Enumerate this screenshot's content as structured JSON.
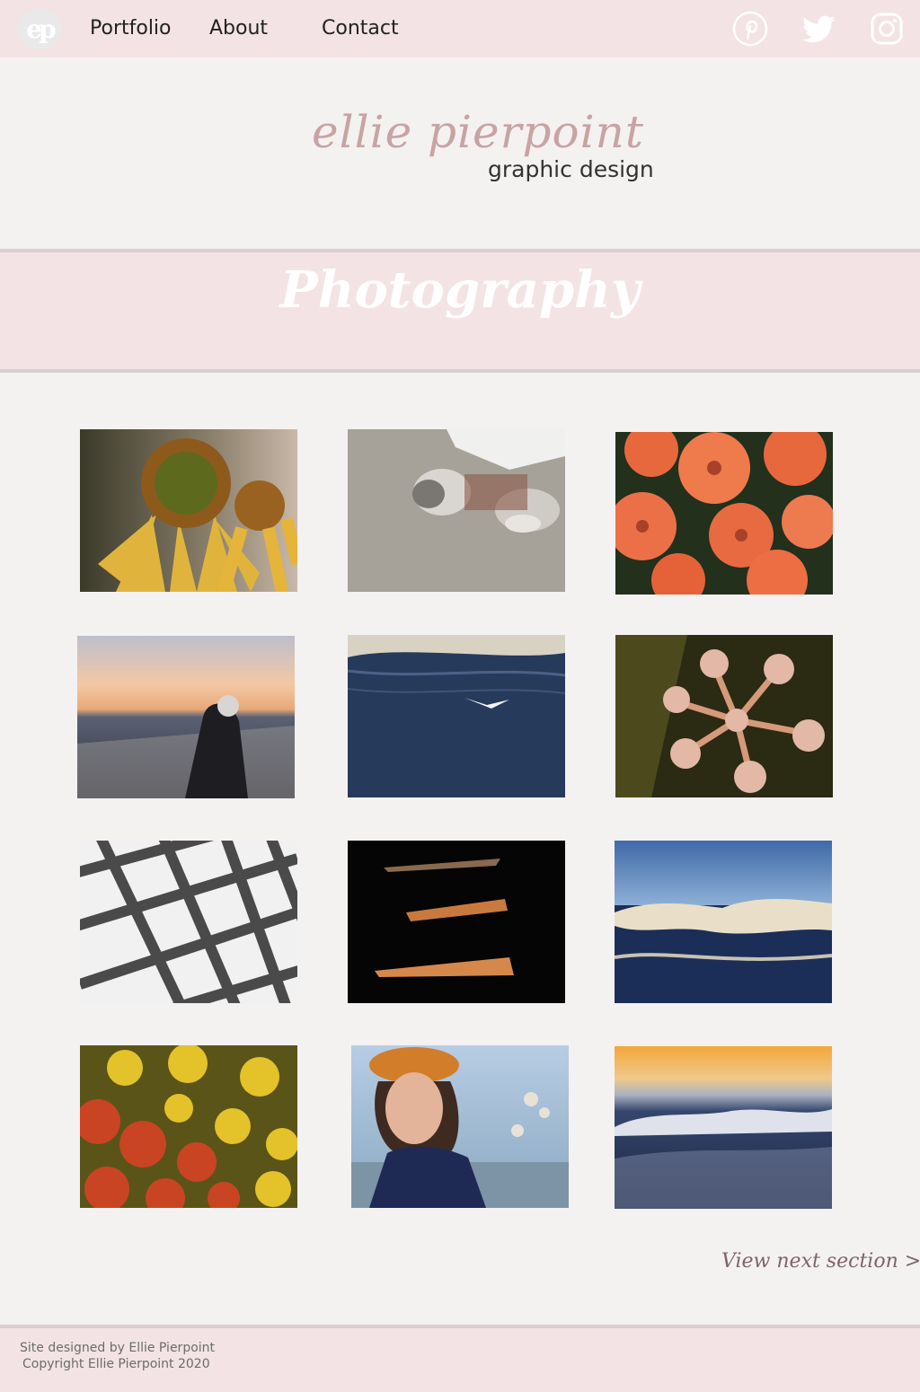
{
  "nav": {
    "logo_text": "ep",
    "links": [
      "Portfolio",
      "About",
      "Contact"
    ],
    "social": [
      "pinterest-icon",
      "twitter-icon",
      "instagram-icon"
    ]
  },
  "header": {
    "name_script": "ellie pierpoint",
    "subtitle": "graphic design"
  },
  "section": {
    "title": "Photography",
    "next_link": "View next section >"
  },
  "gallery": {
    "photos": [
      "coneflower",
      "cat",
      "orange-chrysanthemums",
      "sunset-beach-person",
      "seagull-water",
      "flower-buds",
      "lattice",
      "dark-window-light",
      "ocean-waves",
      "red-yellow-mums",
      "portrait-cap",
      "sunset-waves"
    ]
  },
  "footer": {
    "line1": "Site designed by Ellie Pierpoint",
    "line2": "Copyright Ellie Pierpoint 2020"
  },
  "colors": {
    "nav_bg": "#f3e3e4",
    "page_bg": "#f4f1f1",
    "accent_script": "#c9a3a3",
    "banner_line": "#d9cfd0"
  }
}
